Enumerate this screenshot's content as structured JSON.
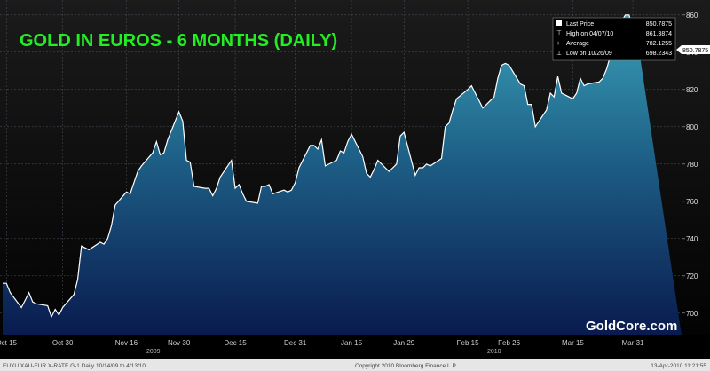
{
  "colors": {
    "title": "#22ee22",
    "area_top": "#2f8fa8",
    "area_bottom": "#0b1f55",
    "line": "#ffffff",
    "background_top": "#1a1a1a",
    "background_bottom": "#000000",
    "footer_bg": "#e8e8e8"
  },
  "legend": {
    "rows": [
      {
        "icon": "square-marker-icon",
        "label": "Last Price",
        "value": "850.7875"
      },
      {
        "icon": "up-tick-icon",
        "label": "High on 04/07/10",
        "value": "861.3874"
      },
      {
        "icon": "plus-marker-icon",
        "label": "Average",
        "value": "782.1255"
      },
      {
        "icon": "down-tick-icon",
        "label": "Low on 10/26/09",
        "value": "698.2343"
      }
    ]
  },
  "watermark": "GoldCore.com",
  "footer": {
    "left": "EUXU XAU-EUR X-RATE   G-1  Daily 10/14/09 to 4/13/10",
    "center": "Copyright 2010 Bloomberg Finance L.P.",
    "right": "13-Apr-2010 11:21:55"
  },
  "chart_data": {
    "type": "area",
    "title": "GOLD IN EUROS - 6 MONTHS (DAILY)",
    "xlabel": "",
    "ylabel": "",
    "ylim": [
      688,
      868
    ],
    "yticks": [
      700,
      720,
      740,
      760,
      780,
      800,
      820,
      840,
      860
    ],
    "grid": true,
    "legend_position": "top-right",
    "last_price_label": "850.7875",
    "x_tick_labels": [
      "Oct 15",
      "Oct 30",
      "Nov 16",
      "Nov 30",
      "Dec 15",
      "Dec 31",
      "Jan 15",
      "Jan 29",
      "Feb 15",
      "Feb 26",
      "Mar 15",
      "Mar 31"
    ],
    "year_labels": [
      "2009",
      "2010"
    ],
    "x": [
      "2009-10-14",
      "2009-10-15",
      "2009-10-16",
      "2009-10-19",
      "2009-10-20",
      "2009-10-21",
      "2009-10-22",
      "2009-10-23",
      "2009-10-26",
      "2009-10-27",
      "2009-10-28",
      "2009-10-29",
      "2009-10-30",
      "2009-11-02",
      "2009-11-03",
      "2009-11-04",
      "2009-11-05",
      "2009-11-06",
      "2009-11-09",
      "2009-11-10",
      "2009-11-11",
      "2009-11-12",
      "2009-11-13",
      "2009-11-16",
      "2009-11-17",
      "2009-11-18",
      "2009-11-19",
      "2009-11-20",
      "2009-11-23",
      "2009-11-24",
      "2009-11-25",
      "2009-11-26",
      "2009-11-27",
      "2009-11-30",
      "2009-12-01",
      "2009-12-02",
      "2009-12-03",
      "2009-12-04",
      "2009-12-07",
      "2009-12-08",
      "2009-12-09",
      "2009-12-10",
      "2009-12-11",
      "2009-12-14",
      "2009-12-15",
      "2009-12-16",
      "2009-12-17",
      "2009-12-18",
      "2009-12-21",
      "2009-12-22",
      "2009-12-23",
      "2009-12-24",
      "2009-12-25",
      "2009-12-28",
      "2009-12-29",
      "2009-12-30",
      "2009-12-31",
      "2010-01-01",
      "2010-01-04",
      "2010-01-05",
      "2010-01-06",
      "2010-01-07",
      "2010-01-08",
      "2010-01-11",
      "2010-01-12",
      "2010-01-13",
      "2010-01-14",
      "2010-01-15",
      "2010-01-18",
      "2010-01-19",
      "2010-01-20",
      "2010-01-21",
      "2010-01-22",
      "2010-01-25",
      "2010-01-26",
      "2010-01-27",
      "2010-01-28",
      "2010-01-29",
      "2010-02-01",
      "2010-02-02",
      "2010-02-03",
      "2010-02-04",
      "2010-02-05",
      "2010-02-08",
      "2010-02-09",
      "2010-02-10",
      "2010-02-11",
      "2010-02-12",
      "2010-02-15",
      "2010-02-16",
      "2010-02-17",
      "2010-02-18",
      "2010-02-19",
      "2010-02-22",
      "2010-02-23",
      "2010-02-24",
      "2010-02-25",
      "2010-02-26",
      "2010-03-01",
      "2010-03-02",
      "2010-03-03",
      "2010-03-04",
      "2010-03-05",
      "2010-03-08",
      "2010-03-09",
      "2010-03-10",
      "2010-03-11",
      "2010-03-12",
      "2010-03-15",
      "2010-03-16",
      "2010-03-17",
      "2010-03-18",
      "2010-03-19",
      "2010-03-22",
      "2010-03-23",
      "2010-03-24",
      "2010-03-25",
      "2010-03-26",
      "2010-03-29",
      "2010-03-30",
      "2010-03-31",
      "2010-04-01",
      "2010-04-02",
      "2010-04-05",
      "2010-04-06",
      "2010-04-07",
      "2010-04-08",
      "2010-04-09",
      "2010-04-12",
      "2010-04-13"
    ],
    "series": [
      {
        "values": [
          716,
          716,
          711,
          703,
          707,
          711,
          706,
          705,
          704,
          698,
          702,
          699,
          703,
          710,
          718,
          736,
          735,
          734,
          738,
          737,
          740,
          747,
          758,
          765,
          764,
          770,
          776,
          779,
          786,
          792,
          785,
          786,
          793,
          808,
          803,
          782,
          781,
          768,
          767,
          767,
          763,
          767,
          773,
          782,
          767,
          769,
          764,
          760,
          759,
          768,
          768,
          769,
          764,
          766,
          765,
          766,
          770,
          778,
          790,
          790,
          788,
          793,
          779,
          782,
          787,
          786,
          792,
          796,
          784,
          775,
          773,
          777,
          782,
          776,
          778,
          780,
          795,
          797,
          774,
          778,
          778,
          780,
          779,
          783,
          800,
          802,
          809,
          815,
          820,
          822,
          818,
          814,
          810,
          816,
          826,
          833,
          834,
          833,
          823,
          822,
          812,
          812,
          800,
          809,
          818,
          816,
          827,
          818,
          815,
          818,
          826,
          822,
          823,
          824,
          826,
          831,
          838,
          850,
          860,
          860,
          853,
          850
        ]
      }
    ]
  }
}
